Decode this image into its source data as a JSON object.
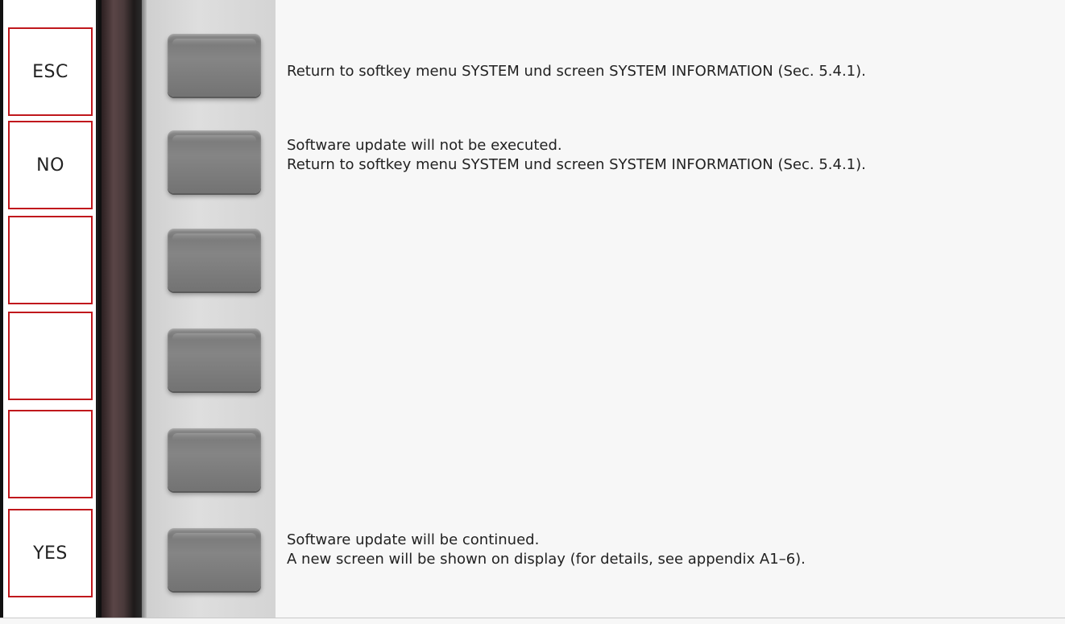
{
  "softkeys": [
    {
      "label": "ESC"
    },
    {
      "label": "NO"
    },
    {
      "label": ""
    },
    {
      "label": ""
    },
    {
      "label": ""
    },
    {
      "label": "YES"
    }
  ],
  "descriptions": {
    "esc": [
      "Return to softkey menu SYSTEM und screen SYSTEM INFORMATION (Sec. 5.4.1)."
    ],
    "no": [
      "Software update will not be executed.",
      "Return to softkey menu SYSTEM und screen SYSTEM INFORMATION (Sec. 5.4.1)."
    ],
    "yes": [
      "Software update will be continued.",
      "A new screen will be shown on display (for details, see appendix A1–6)."
    ]
  },
  "colors": {
    "softkey_border": "#c0181c",
    "button_gray": "#7a7a7a",
    "background": "#f7f7f7"
  }
}
